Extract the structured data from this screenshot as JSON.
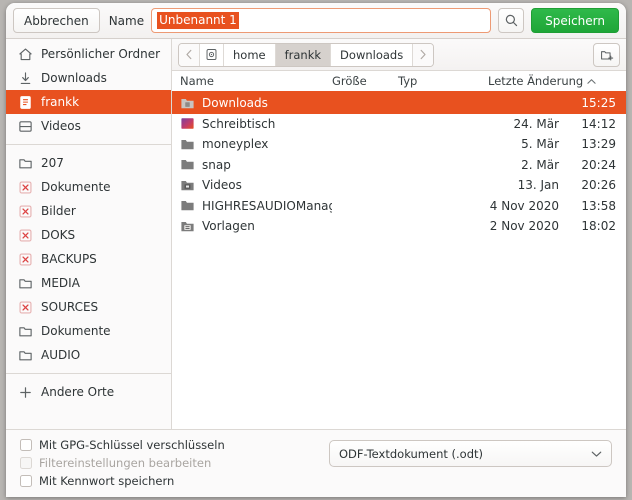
{
  "header": {
    "cancel_label": "Abbrechen",
    "name_label": "Name",
    "name_value": "Unbenannt 1",
    "search_icon": "search-icon",
    "save_label": "Speichern"
  },
  "sidebar": {
    "groups": [
      {
        "items": [
          {
            "label": "Persönlicher Ordner",
            "icon": "home-icon",
            "state": "normal"
          },
          {
            "label": "Downloads",
            "icon": "download-icon",
            "state": "normal"
          },
          {
            "label": "frankk",
            "icon": "document-icon",
            "state": "selected"
          },
          {
            "label": "Videos",
            "icon": "media-icon",
            "state": "normal"
          }
        ]
      },
      {
        "items": [
          {
            "label": "207",
            "icon": "folder-icon",
            "state": "normal"
          },
          {
            "label": "Dokumente",
            "icon": "missing-icon",
            "state": "normal"
          },
          {
            "label": "Bilder",
            "icon": "missing-icon",
            "state": "normal"
          },
          {
            "label": "DOKS",
            "icon": "missing-icon",
            "state": "normal"
          },
          {
            "label": "BACKUPS",
            "icon": "missing-icon",
            "state": "normal"
          },
          {
            "label": "MEDIA",
            "icon": "folder-icon",
            "state": "normal"
          },
          {
            "label": "SOURCES",
            "icon": "missing-icon",
            "state": "normal"
          },
          {
            "label": "Dokumente",
            "icon": "folder-icon",
            "state": "normal"
          },
          {
            "label": "AUDIO",
            "icon": "folder-icon",
            "state": "normal"
          }
        ]
      },
      {
        "items": [
          {
            "label": "Andere Orte",
            "icon": "plus-icon",
            "state": "normal"
          }
        ]
      }
    ]
  },
  "pathbar": {
    "back_icon": "chevron-left-icon",
    "device_icon": "drive-icon",
    "crumbs": [
      {
        "label": "home",
        "active": false
      },
      {
        "label": "frankk",
        "active": true
      },
      {
        "label": "Downloads",
        "active": false
      }
    ],
    "forward_icon": "chevron-right-icon",
    "new_folder_icon": "new-folder-icon"
  },
  "filelist": {
    "columns": {
      "name": "Name",
      "size": "Größe",
      "type": "Typ",
      "modified": "Letzte Änderung",
      "sort_icon": "chevron-up-icon"
    },
    "rows": [
      {
        "name": "Downloads",
        "icon": "folder-download-icon",
        "size": "",
        "type": "",
        "date": "",
        "time": "15:25",
        "selected": true
      },
      {
        "name": "Schreibtisch",
        "icon": "desktop-icon",
        "size": "",
        "type": "",
        "date": "24. Mär",
        "time": "14:12",
        "selected": false
      },
      {
        "name": "moneyplex",
        "icon": "folder-icon",
        "size": "",
        "type": "",
        "date": "5. Mär",
        "time": "13:29",
        "selected": false
      },
      {
        "name": "snap",
        "icon": "folder-icon",
        "size": "",
        "type": "",
        "date": "2. Mär",
        "time": "20:24",
        "selected": false
      },
      {
        "name": "Videos",
        "icon": "folder-video-icon",
        "size": "",
        "type": "",
        "date": "13. Jan",
        "time": "20:26",
        "selected": false
      },
      {
        "name": "HIGHRESAUDIOManager",
        "icon": "folder-icon",
        "size": "",
        "type": "",
        "date": "4 Nov 2020",
        "time": "13:58",
        "selected": false
      },
      {
        "name": "Vorlagen",
        "icon": "folder-template-icon",
        "size": "",
        "type": "",
        "date": "2 Nov 2020",
        "time": "18:02",
        "selected": false
      }
    ]
  },
  "footer": {
    "checkboxes": [
      {
        "label": "Mit GPG-Schlüssel verschlüsseln",
        "checked": false,
        "disabled": false
      },
      {
        "label": "Filtereinstellungen bearbeiten",
        "checked": false,
        "disabled": true
      },
      {
        "label": "Mit Kennwort speichern",
        "checked": false,
        "disabled": false
      }
    ],
    "filetype_value": "ODF-Textdokument (.odt)",
    "filetype_chevron": "chevron-down-icon"
  },
  "colors": {
    "accent": "#e8511f",
    "save_green": "#22a83b",
    "sidebar_bg": "#fbfafa"
  }
}
